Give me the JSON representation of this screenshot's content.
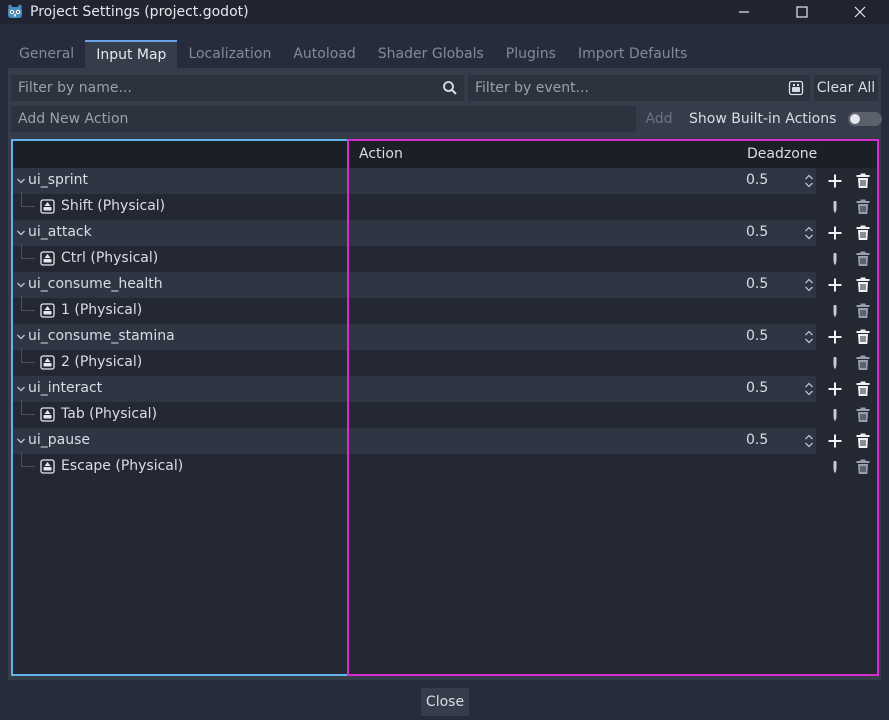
{
  "window": {
    "title": "Project Settings (project.godot)",
    "icon": "godot-logo-icon",
    "controls": [
      "minimize-icon",
      "maximize-icon",
      "close-icon"
    ]
  },
  "tabs": [
    {
      "label": "General",
      "active": false
    },
    {
      "label": "Input Map",
      "active": true
    },
    {
      "label": "Localization",
      "active": false
    },
    {
      "label": "Autoload",
      "active": false
    },
    {
      "label": "Shader Globals",
      "active": false
    },
    {
      "label": "Plugins",
      "active": false
    },
    {
      "label": "Import Defaults",
      "active": false
    }
  ],
  "filters": {
    "name_placeholder": "Filter by name...",
    "event_placeholder": "Filter by event...",
    "clear_all": "Clear All"
  },
  "add_action": {
    "placeholder": "Add New Action",
    "add_label": "Add",
    "show_builtin_label": "Show Built-in Actions",
    "show_builtin_on": false
  },
  "table": {
    "col_action": "Action",
    "col_deadzone": "Deadzone",
    "actions": [
      {
        "name": "ui_sprint",
        "deadzone": "0.5",
        "event": "Shift (Physical)"
      },
      {
        "name": "ui_attack",
        "deadzone": "0.5",
        "event": "Ctrl (Physical)"
      },
      {
        "name": "ui_consume_health",
        "deadzone": "0.5",
        "event": "1 (Physical)"
      },
      {
        "name": "ui_consume_stamina",
        "deadzone": "0.5",
        "event": "2 (Physical)"
      },
      {
        "name": "ui_interact",
        "deadzone": "0.5",
        "event": "Tab (Physical)"
      },
      {
        "name": "ui_pause",
        "deadzone": "0.5",
        "event": "Escape (Physical)"
      }
    ]
  },
  "footer": {
    "close_label": "Close"
  },
  "colors": {
    "accent_blue": "#63b3e8",
    "accent_pink": "#d42fce",
    "tab_accent": "#6aa3e6"
  }
}
